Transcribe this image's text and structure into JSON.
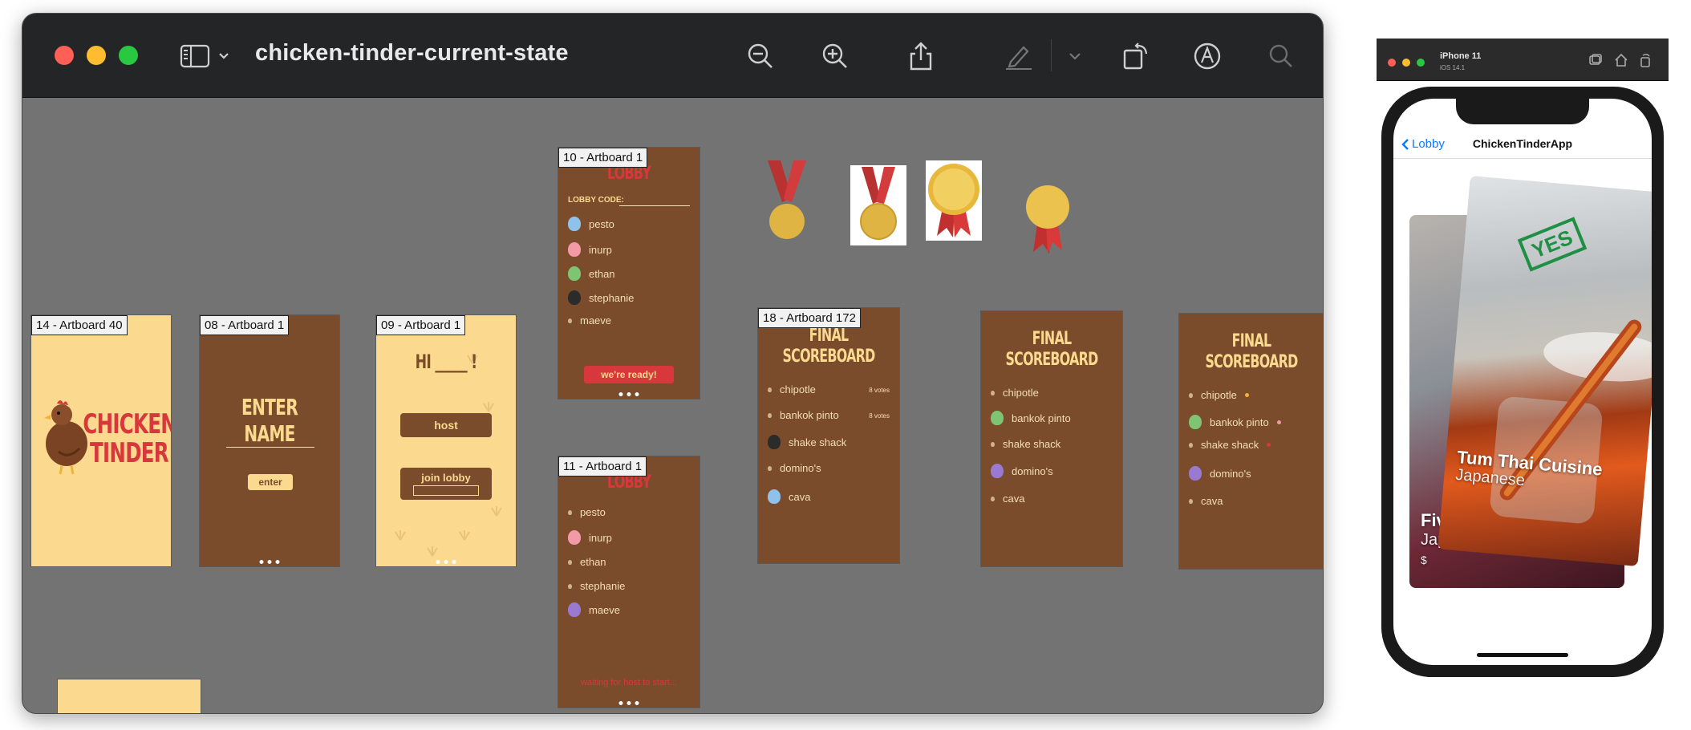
{
  "window": {
    "title": "chicken-tinder-current-state",
    "toolbar_icons": [
      "sidebar-toggle-icon",
      "chevron-down-icon",
      "zoom-out-icon",
      "zoom-in-icon",
      "share-icon",
      "highlight-pen-icon",
      "chevron-down-icon",
      "rotate-icon",
      "markup-icon",
      "search-icon"
    ]
  },
  "artboards": {
    "a14": {
      "label": "14 - Artboard 40",
      "logo_line1": "CHICKEN",
      "logo_line2": "TINDER"
    },
    "a08": {
      "label": "08 - Artboard 1",
      "heading": "ENTER NAME",
      "button": "enter"
    },
    "a09": {
      "label": "09 - Artboard 1",
      "heading": "HI _____ !",
      "host_button": "host",
      "join_button": "join lobby"
    },
    "a10": {
      "label": "10 - Artboard 1",
      "heading": "LOBBY",
      "lobby_code_label": "LOBBY CODE:",
      "players": [
        "pesto",
        "inurp",
        "ethan",
        "stephanie",
        "maeve"
      ],
      "ready_button": "we're ready!"
    },
    "a11": {
      "label": "11 - Artboard 1",
      "heading": "LOBBY",
      "players": [
        "pesto",
        "inurp",
        "ethan",
        "stephanie",
        "maeve"
      ],
      "waiting_text": "waiting for host to start..."
    },
    "a18": {
      "label": "18 - Artboard 172",
      "heading_1": "FINAL",
      "heading_2": "SCOREBOARD",
      "items": [
        "chipotle",
        "bankok pinto",
        "shake shack",
        "domino's",
        "cava"
      ],
      "votes": [
        "8 votes",
        "8 votes"
      ]
    },
    "fs2": {
      "heading_1": "FINAL",
      "heading_2": "SCOREBOARD",
      "items": [
        "chipotle",
        "bankok pinto",
        "shake shack",
        "domino's",
        "cava"
      ]
    },
    "fs3": {
      "heading_1": "FINAL",
      "heading_2": "SCOREBOARD",
      "items": [
        "chipotle",
        "bankok pinto",
        "shake shack",
        "domino's",
        "cava"
      ]
    }
  },
  "simulator": {
    "device": "iPhone 11",
    "os": "iOS 14.1",
    "back_label": "Lobby",
    "nav_title": "ChickenTinderApp",
    "front_card": {
      "name": "Tum Thai Cuisine",
      "cuisine": "Japanese"
    },
    "back_card": {
      "name": "Five",
      "cuisine": "Japanese",
      "price": "$"
    },
    "swipe_label": "YES"
  },
  "colors": {
    "brown": "#7b4c2b",
    "cream": "#fbd98f",
    "logo_red": "#d8383b",
    "ios_blue": "#0a7aff",
    "yes_green": "#1f8f43"
  }
}
